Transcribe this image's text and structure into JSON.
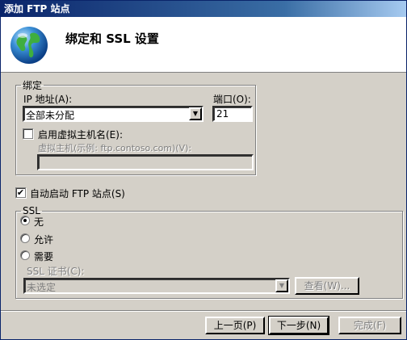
{
  "window": {
    "title": "添加 FTP 站点"
  },
  "header": {
    "title": "绑定和 SSL 设置",
    "icon": "globe-icon"
  },
  "binding": {
    "group_label": "绑定",
    "ip_label": "IP 地址(A):",
    "ip_value": "全部未分配",
    "port_label": "端口(O):",
    "port_value": "21",
    "virtual_host_checkbox_label": "启用虚拟主机名(E):",
    "virtual_host_checked": false,
    "virtual_host_label": "虚拟主机(示例: ftp.contoso.com)(V):",
    "virtual_host_value": ""
  },
  "auto_start": {
    "label": "自动启动 FTP 站点(S)",
    "checked": true
  },
  "ssl": {
    "group_label": "SSL",
    "options": [
      {
        "label": "无",
        "checked": true
      },
      {
        "label": "允许",
        "checked": false
      },
      {
        "label": "需要",
        "checked": false
      }
    ],
    "cert_label": "SSL 证书(C):",
    "cert_value": "未选定",
    "view_button": "查看(W)..."
  },
  "footer": {
    "prev_button": "上一页(P)",
    "next_button": "下一步(N)",
    "finish_button": "完成(F)"
  }
}
